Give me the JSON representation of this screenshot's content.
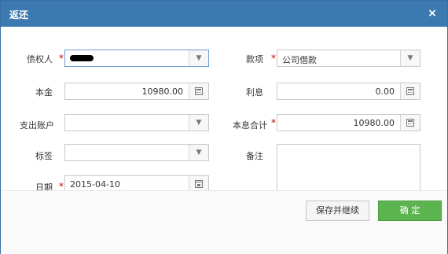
{
  "dialog": {
    "title": "返还",
    "close_glyph": "×",
    "colors": {
      "titlebar": "#3d79b1",
      "primary_button": "#5cb450",
      "required_mark": "#c00000"
    }
  },
  "form": {
    "creditor": {
      "label": "债权人",
      "value": "",
      "redacted": true
    },
    "item": {
      "label": "款项",
      "value": "公司借款"
    },
    "principal": {
      "label": "本金",
      "value": "10980.00"
    },
    "interest": {
      "label": "利息",
      "value": "0.00"
    },
    "account": {
      "label": "支出账户",
      "value": ""
    },
    "total": {
      "label": "本息合计",
      "value": "10980.00"
    },
    "tag": {
      "label": "标签",
      "value": ""
    },
    "note": {
      "label": "备注",
      "value": ""
    },
    "date": {
      "label": "日期",
      "value": "2015-04-10"
    },
    "required_mark": "*"
  },
  "footer": {
    "save_continue_label": "保存并继续",
    "confirm_label": "确 定"
  }
}
